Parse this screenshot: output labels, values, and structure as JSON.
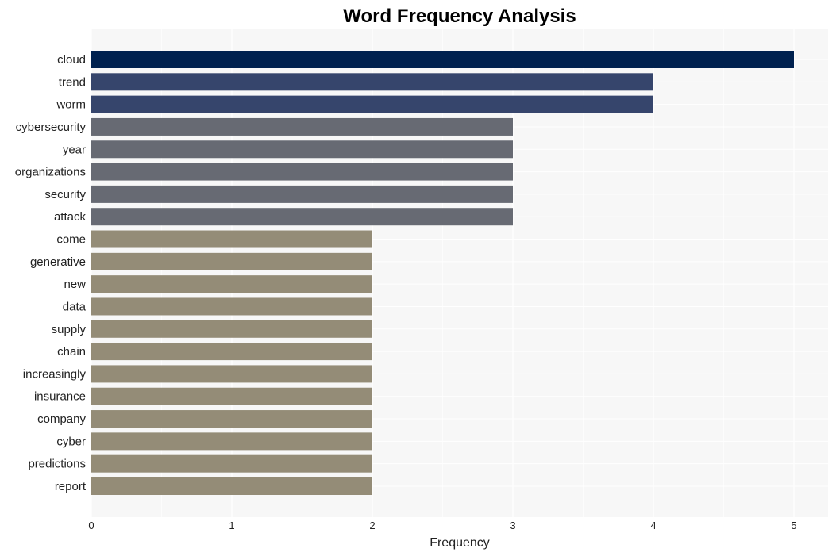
{
  "chart_data": {
    "type": "bar",
    "orientation": "horizontal",
    "title": "Word Frequency Analysis",
    "xlabel": "Frequency",
    "ylabel": "",
    "xlim": [
      0,
      5.25
    ],
    "xticks": [
      0,
      1,
      2,
      3,
      4,
      5
    ],
    "grid": true,
    "legend": "none",
    "categories": [
      "cloud",
      "trend",
      "worm",
      "cybersecurity",
      "year",
      "organizations",
      "security",
      "attack",
      "come",
      "generative",
      "new",
      "data",
      "supply",
      "chain",
      "increasingly",
      "insurance",
      "company",
      "cyber",
      "predictions",
      "report"
    ],
    "values": [
      5,
      4,
      4,
      3,
      3,
      3,
      3,
      3,
      2,
      2,
      2,
      2,
      2,
      2,
      2,
      2,
      2,
      2,
      2,
      2
    ],
    "colors_by_value": {
      "5": "#00214f",
      "4": "#36456c",
      "3": "#676a73",
      "2": "#948c77"
    },
    "plot_background": "#f7f7f7",
    "grid_color": "#ffffff"
  }
}
